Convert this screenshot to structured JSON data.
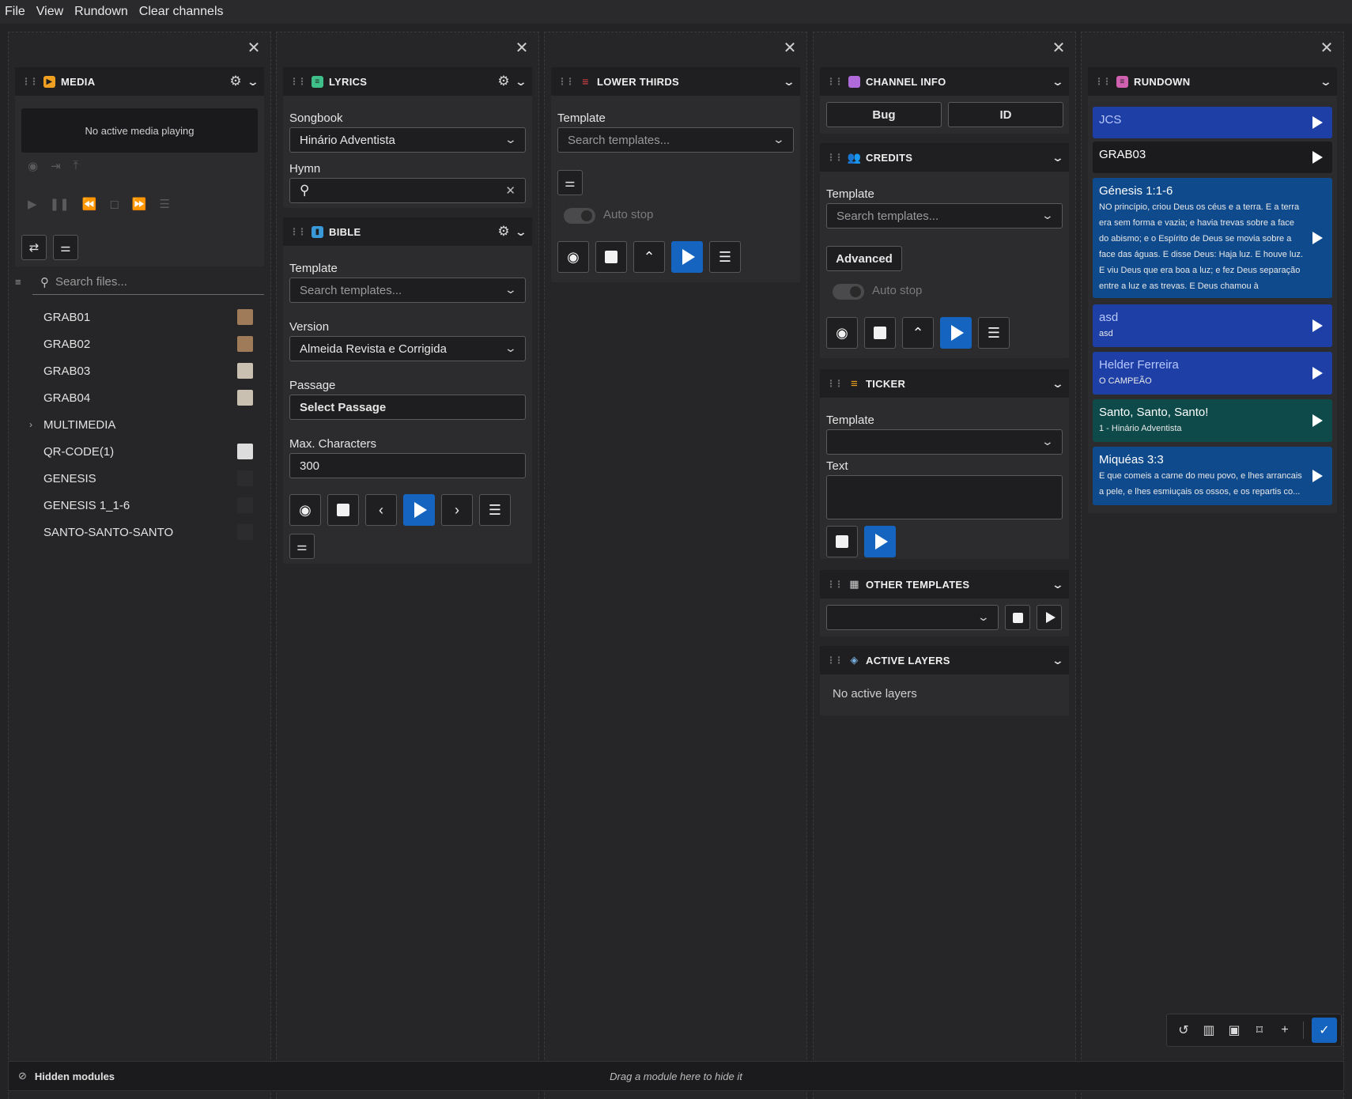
{
  "menu": [
    "File",
    "View",
    "Rundown",
    "Clear channels"
  ],
  "media": {
    "title": "MEDIA",
    "status": "No active media playing",
    "search_placeholder": "Search files...",
    "files": [
      {
        "name": "GRAB01",
        "thumb": "#a07b5a"
      },
      {
        "name": "GRAB02",
        "thumb": "#a07b5a"
      },
      {
        "name": "GRAB03",
        "thumb": "#c9c0b2"
      },
      {
        "name": "GRAB04",
        "thumb": "#c9c0b2"
      },
      {
        "name": "MULTIMEDIA",
        "folder": true
      },
      {
        "name": "QR-CODE(1)",
        "thumb": "#dddddd"
      },
      {
        "name": "GENESIS",
        "thumb": "#2c2c2e"
      },
      {
        "name": "GENESIS 1_1-6",
        "thumb": "#2c2c2e"
      },
      {
        "name": "SANTO-SANTO-SANTO",
        "thumb": "#2c2c2e"
      }
    ]
  },
  "lyrics": {
    "title": "LYRICS",
    "songbook_label": "Songbook",
    "songbook_value": "Hinário Adventista",
    "hymn_label": "Hymn"
  },
  "bible": {
    "title": "BIBLE",
    "template_label": "Template",
    "template_placeholder": "Search templates...",
    "version_label": "Version",
    "version_value": "Almeida Revista e Corrigida",
    "passage_label": "Passage",
    "passage_button": "Select Passage",
    "maxchars_label": "Max. Characters",
    "maxchars_value": "300"
  },
  "lower_thirds": {
    "title": "LOWER THIRDS",
    "template_label": "Template",
    "template_placeholder": "Search templates...",
    "autostop_label": "Auto stop"
  },
  "channel_info": {
    "title": "CHANNEL INFO",
    "bug_label": "Bug",
    "id_label": "ID"
  },
  "credits": {
    "title": "CREDITS",
    "template_label": "Template",
    "template_placeholder": "Search templates...",
    "advanced_label": "Advanced",
    "autostop_label": "Auto stop"
  },
  "ticker": {
    "title": "TICKER",
    "template_label": "Template",
    "text_label": "Text"
  },
  "other_templates": {
    "title": "OTHER TEMPLATES"
  },
  "active_layers": {
    "title": "ACTIVE LAYERS",
    "empty": "No active layers"
  },
  "rundown": {
    "title": "RUNDOWN",
    "items": [
      {
        "title": "JCS",
        "sub": "",
        "color": "#1e3fa6"
      },
      {
        "title": "GRAB03",
        "sub": "",
        "color": "#1b1b1d"
      },
      {
        "title": "Génesis 1:1-6",
        "sub": "NO princípio, criou Deus os céus e a terra. E a terra era sem forma e vazia; e havia trevas sobre a face do abismo; e o Espírito de Deus se movia sobre a face das águas. E disse Deus: Haja luz. E houve luz. E viu Deus que era boa a luz; e fez Deus separação entre a luz e as trevas. E Deus chamou à",
        "color": "#0f4a8c"
      },
      {
        "title": "asd",
        "sub": "asd",
        "color": "#1e3fa6"
      },
      {
        "title": "Helder Ferreira",
        "sub": "O CAMPEÃO",
        "color": "#1e3fa6"
      },
      {
        "title": "Santo, Santo, Santo!",
        "sub": "1 - Hinário Adventista",
        "color": "#0e4a4a"
      },
      {
        "title": "Miquéas 3:3",
        "sub": "E que comeis a carne do meu povo, e lhes arrancais a pele, e lhes esmiuçais os ossos, e os repartis co...",
        "color": "#0f4a8c"
      }
    ]
  },
  "bottom": {
    "hidden_label": "Hidden modules",
    "drop_hint": "Drag a module here to hide it"
  }
}
